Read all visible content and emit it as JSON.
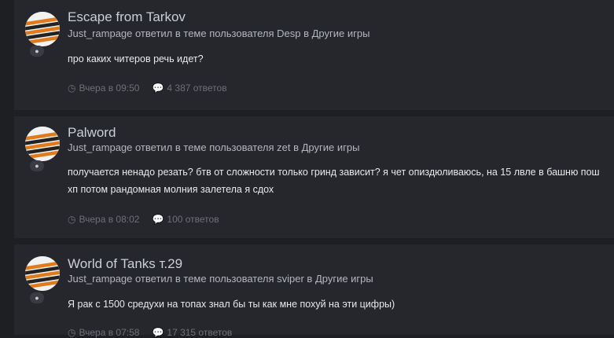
{
  "entries": [
    {
      "title": "Escape from Tarkov",
      "byline": "Just_rampage ответил в теме пользователя Desp в Другие игры",
      "lines": [
        "про каких читеров речь идет?"
      ],
      "time": "Вчера в 09:50",
      "replies": "4 387 ответов"
    },
    {
      "title": "Palword",
      "byline": "Just_rampage ответил в теме пользователя zet в Другие игры",
      "lines": [
        "получается ненадо резать? бтв от сложности только гринд зависит? я чет опиздюливаюсь, на 15 лвле в башню пош",
        "хп потом рандомная молния залетела я сдох"
      ],
      "time": "Вчера в 08:02",
      "replies": "100 ответов"
    },
    {
      "title": "World of Tanks т.29",
      "byline": "Just_rampage ответил в теме пользователя sviper в Другие игры",
      "lines": [
        "Я рак с 1500 средухи на топах знал бы ты как мне похуй на эти цифры)"
      ],
      "time": "Вчера в 07:58",
      "replies": "17 315 ответов"
    }
  ],
  "icons": {
    "time": "clock-icon",
    "replies": "comment-icon",
    "badge": "comment-badge-icon"
  },
  "colors": {
    "background": "#1e1f23",
    "card": "#26272c",
    "meta": "#6d7079"
  }
}
